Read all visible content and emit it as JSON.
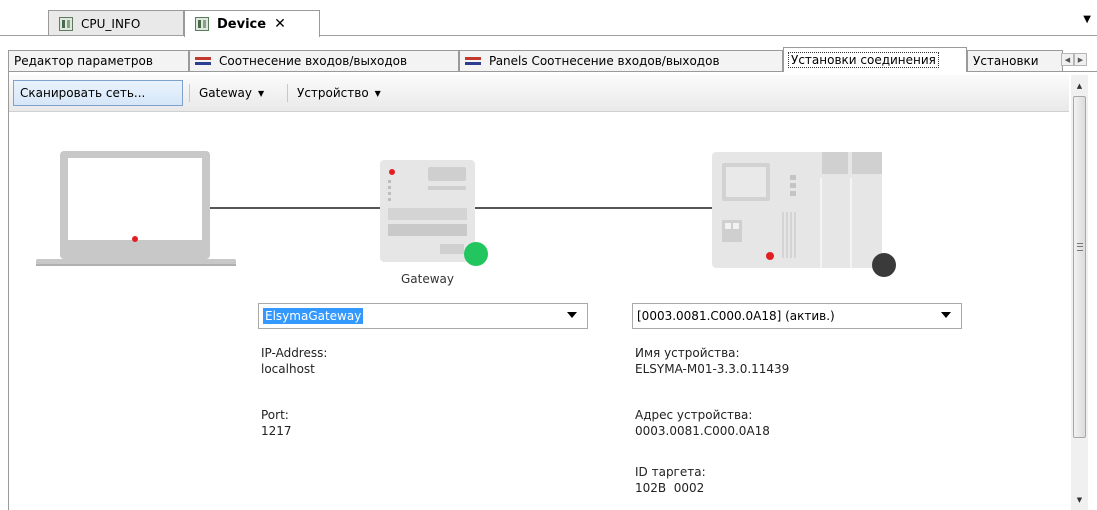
{
  "doc_tabs": [
    {
      "label": "CPU_INFO",
      "active": false
    },
    {
      "label": "Device",
      "active": true,
      "close": "✕"
    }
  ],
  "sub_tabs": [
    {
      "label": "Редактор параметров",
      "icon": ""
    },
    {
      "label": "Соотнесение входов/выходов",
      "icon": "io-mapping-icon"
    },
    {
      "label": "Panels Соотнесение входов/выходов",
      "icon": "io-mapping-icon"
    },
    {
      "label": "Установки соединения",
      "icon": "",
      "active": true
    },
    {
      "label": "Установки",
      "icon": ""
    }
  ],
  "toolbar": {
    "scan_label": "Сканировать сеть...",
    "gateway_label": "Gateway",
    "device_label": "Устройство"
  },
  "diagram": {
    "gateway_caption": "Gateway",
    "gateway_status_color": "#22c55e",
    "device_status_color": "#3a3a3a"
  },
  "gateway": {
    "selected": "ElsymaGateway",
    "ip_label": "IP-Address:",
    "ip_value": "localhost",
    "port_label": "Port:",
    "port_value": "1217"
  },
  "device": {
    "selected": "[0003.0081.C000.0A18] (актив.)",
    "name_label": "Имя устройства:",
    "name_value": "ELSYMA-M01-3.3.0.11439",
    "address_label": "Адрес устройства:",
    "address_value": "0003.0081.C000.0A18",
    "target_label": "ID таргета:",
    "target_value": "102B  0002"
  }
}
